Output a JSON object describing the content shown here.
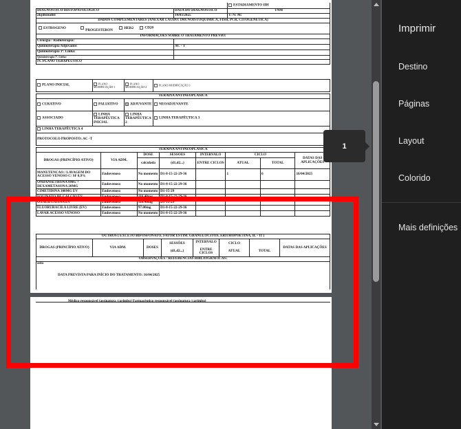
{
  "tooltip": {
    "page_number": "1"
  },
  "panel": {
    "title": "Imprimir",
    "items": [
      "Destino",
      "Páginas",
      "Layout",
      "Colorido",
      "Mais definições"
    ]
  },
  "form": {
    "estadiamento": "ESTADIAMENTO IIH",
    "diag_label": "DIAGNÓSTICO HISTOPATOLÓGICO",
    "diag_value": "akjdfoiudlsf",
    "data_diag_label": "DATA DO DIAGNÓSTICO",
    "data_diag_value": "14/03/2025",
    "tnm_label": "TNM",
    "tnm_value": "T: N: M:",
    "dados_header": "DADOS COMPLEMENTARES (ANEXAR LAUDO: IMUNOISTOQUÍMICA, FISH, PCR, CITOGENÉTICA)",
    "estrogeno": "ESTROGENO",
    "progesteron": "PROGESTERON",
    "her2": "HER2",
    "cd20": "CD20",
    "info_header": "INFORMAÇÕES SOBRE O TRATAMENTO PRÉVIO:",
    "cirurgia": "Cirurgia / Radioterapia:",
    "quimio_adj": "Quimioterapia Adjuvante:",
    "quimio_adj_value": "AC - T",
    "quimio_1": "Quimioterapia 1ª. Linha:",
    "quimio_7": "Quimioterapia 7ª. Linha:",
    "plano_header": "IV. PLANO TERAPÊUTICO",
    "plano_inicial": "PLANO INICIAL",
    "plano_mod1": "PLANO MODIFICAÇÃO 1",
    "plano_mod2": "PLANO MODIFICAÇÃO 2",
    "plano_mod3": "PLANO MODIFICAÇÃO 3",
    "terapia_header": "TERAPIA ANTINEOPLÁSICA",
    "curativo": "CURATIVO",
    "paliativo": "PALIATIVO",
    "adjuvante": "ADJUVANTE",
    "neoadjuvante": "NEOADJUVANTE",
    "associado": "ASSOCIADO",
    "linha_inicial": "LINHA TERAPÊUTICA INICIAL",
    "linha_2": "LINHA TERAPÊUTICA 2",
    "linha_3": "LINHA TERAPÊUTICA 3",
    "linha_4": "LINHA TERAPÊUTICA 4",
    "protocolo": "PROTOCOLO PROPOSTO: AC -T",
    "drug_table": {
      "header": "TERAPIA ANTINEOPLÁSICA",
      "col_drogas": "DROGAS (PRINCÍPIO ATIVO)",
      "col_via": "VIA ADM.",
      "col_dose": "DOSE",
      "col_dose_sub": "calculada",
      "col_sessoes": "SESSÕES",
      "col_sessoes_sub": "(d1,d2...)",
      "col_intervalo": "INTERVALO",
      "col_intervalo_sub": "ENTRE CICLOS",
      "col_ciclo": "CICLO",
      "col_atual": "ATUAL",
      "col_total": "TOTAL",
      "col_datas": "DATAS DAS APLICAÇÕES",
      "rows": [
        {
          "droga": "MANUTENCAO / LAVAGEM DO ACESSO VENOSO C/ SF 0,9%",
          "via": "Endovenoso",
          "dose": "No momento",
          "sessoes": "D1-8-15-22-29-36",
          "intervalo": "",
          "atual": "1",
          "total": "6",
          "datas": "16/04/2025"
        },
        {
          "droga": "ONDANSETRONA 8MG + DEXAMETASONA 20MG",
          "via": "Endovenoso",
          "dose": "No momento",
          "sessoes": "D1-8-15-22-29-36",
          "intervalo": "",
          "atual": "",
          "total": "",
          "datas": ""
        },
        {
          "droga": "CIMETIDINA 300MG EV",
          "via": "Endovenoso",
          "dose": "No momento",
          "sessoes": "D1-15-29",
          "intervalo": "",
          "atual": "",
          "total": "",
          "datas": ""
        },
        {
          "droga": "FOLINATO DE CALCIO EV",
          "via": "Endovenoso",
          "dose": "116.40mg",
          "sessoes": "D1-8-15-22-29-36",
          "intervalo": "",
          "atual": "",
          "total": "",
          "datas": ""
        },
        {
          "droga": "OXALIPLATINA EV",
          "via": "Endovenoso",
          "dose": "116.40mg",
          "sessoes": "D1-15-29",
          "intervalo": "",
          "atual": "",
          "total": "",
          "datas": ""
        },
        {
          "droga": "FLUORURACILA LIVRE (EV)",
          "via": "Endovenoso",
          "dose": "97.00mg",
          "sessoes": "D1-8-15-22-29-36",
          "intervalo": "",
          "atual": "",
          "total": "",
          "datas": ""
        },
        {
          "droga": "LAVAR ACESSO VENOSO",
          "via": "Endovenoso",
          "dose": "No momento",
          "sessoes": "D1-8-15-22-29-36",
          "intervalo": "",
          "atual": "",
          "total": "",
          "datas": ""
        }
      ]
    },
    "outros_header": "OUTROS ( EXCETO BIFOSFONATO, FATOR ESTIM. GRANULOCITOS, ERITROPOETINA, IL - 11 )",
    "outros_drogas": "DROGAS (PRINCÍPIO ATIVO)",
    "outros_via": "VIA ADM.",
    "outros_doses": "DOSES",
    "obs_header": "OBSERVAÇÕES / REFERÊNCIAS BIBLIOGRÁFICAS:",
    "obs_value": "asfa",
    "data_prevista": "DATA PREVISTA PARA INÍCIO DO TRATAMENTO: 16/04/2025",
    "assinatura": "Médico responsável (assinatura /carimbo) Farmacêutico responsável (assinatura /carimbo)"
  }
}
